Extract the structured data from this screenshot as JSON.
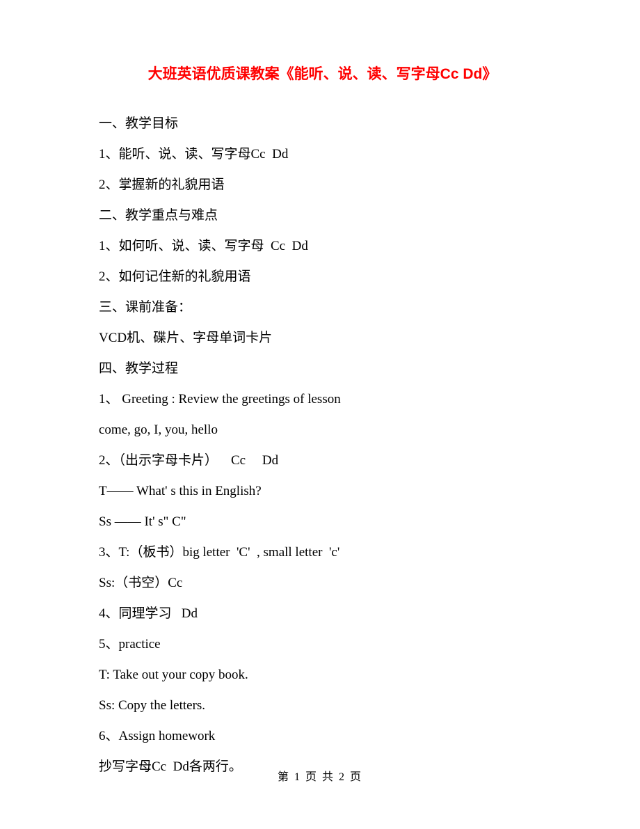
{
  "title": "大班英语优质课教案《能听、说、读、写字母Cc  Dd》",
  "lines": {
    "l0": "一、教学目标",
    "l1": "1、能听、说、读、写字母Cc  Dd",
    "l2": "2、掌握新的礼貌用语",
    "l3": "二、教学重点与难点",
    "l4": "1、如何听、说、读、写字母  Cc  Dd",
    "l5": "2、如何记住新的礼貌用语",
    "l6": "三、课前准备：",
    "l7": "VCD机、碟片、字母单词卡片",
    "l8": "四、教学过程",
    "l9": "1、 Greeting : Review the greetings of lesson",
    "l10": "come, go, I, you, hello",
    "l11": "2、（出示字母卡片）    Cc     Dd",
    "l12": "T—— What' s this in English?",
    "l13": "Ss —— It' s\" C\"",
    "l14": "3、T:（板书）big letter  'C'  , small letter  'c'",
    "l15": "Ss:（书空）Cc",
    "l16": "4、同理学习   Dd",
    "l17": "5、practice",
    "l18": "T: Take out your copy book.",
    "l19": "Ss: Copy the letters.",
    "l20": "6、Assign homework",
    "l21": "抄写字母Cc  Dd各两行。"
  },
  "footer": "第 1 页 共 2 页"
}
